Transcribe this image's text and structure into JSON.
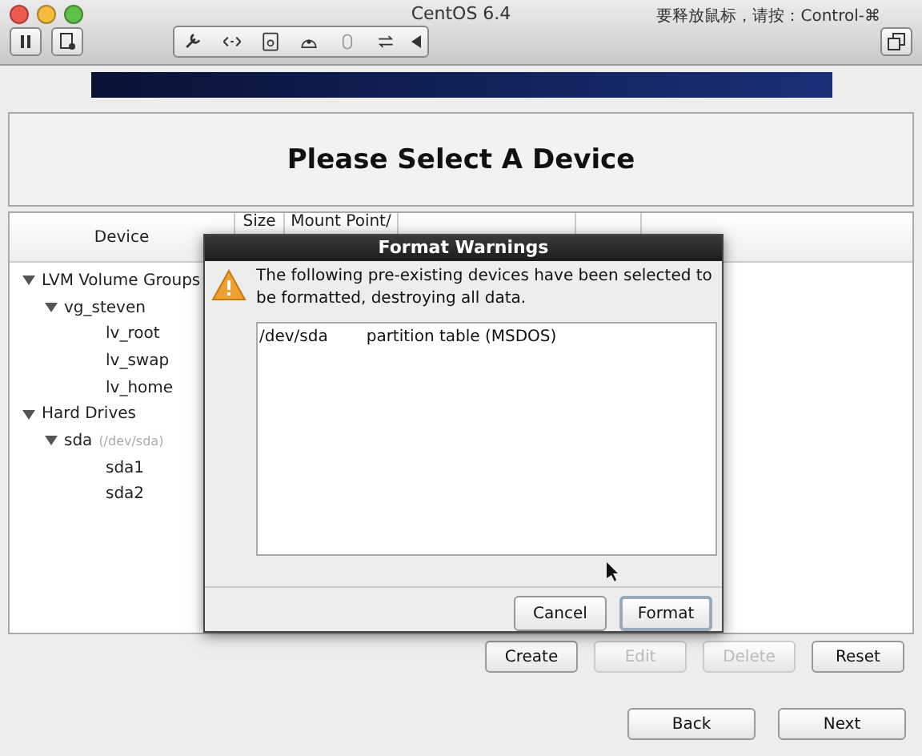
{
  "window": {
    "title": "CentOS 6.4",
    "hint": "要释放鼠标，请按：Control-⌘"
  },
  "heading": "Please Select A Device",
  "table": {
    "columns": [
      "Device",
      "Size",
      "Mount Point/"
    ],
    "tree": [
      {
        "label": "LVM Volume Groups",
        "expanded": true,
        "children": [
          {
            "label": "vg_steven",
            "expanded": true,
            "children": [
              {
                "label": "lv_root"
              },
              {
                "label": "lv_swap"
              },
              {
                "label": "lv_home"
              }
            ]
          }
        ]
      },
      {
        "label": "Hard Drives",
        "expanded": true,
        "children": [
          {
            "label": "sda",
            "note": "(/dev/sda)",
            "expanded": true,
            "children": [
              {
                "label": "sda1"
              },
              {
                "label": "sda2"
              }
            ]
          }
        ]
      }
    ]
  },
  "actions": [
    {
      "label": "Create",
      "disabled": false
    },
    {
      "label": "Edit",
      "disabled": true
    },
    {
      "label": "Delete",
      "disabled": true
    },
    {
      "label": "Reset",
      "disabled": false
    }
  ],
  "nav": [
    "Back",
    "Next"
  ],
  "dialog": {
    "title": "Format Warnings",
    "message": "The following pre-existing devices have been selected to be formatted, destroying all data.",
    "list": [
      {
        "device": "/dev/sda",
        "description": "partition table (MSDOS)"
      }
    ],
    "buttons": [
      {
        "label": "Cancel",
        "default": false
      },
      {
        "label": "Format",
        "default": true
      }
    ]
  }
}
